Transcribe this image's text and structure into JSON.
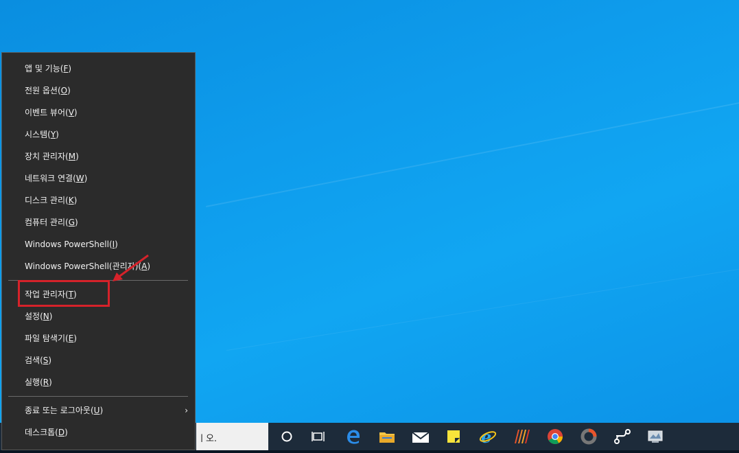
{
  "menu": {
    "items": [
      {
        "label": "앱 및 기능",
        "key": "F"
      },
      {
        "label": "전원 옵션",
        "key": "O"
      },
      {
        "label": "이벤트 뷰어",
        "key": "V"
      },
      {
        "label": "시스템",
        "key": "Y"
      },
      {
        "label": "장치 관리자",
        "key": "M"
      },
      {
        "label": "네트워크 연결",
        "key": "W"
      },
      {
        "label": "디스크 관리",
        "key": "K"
      },
      {
        "label": "컴퓨터 관리",
        "key": "G"
      },
      {
        "label": "Windows PowerShell",
        "key": "I"
      },
      {
        "label": "Windows PowerShell(관리자)",
        "key": "A"
      },
      {
        "label": "작업 관리자",
        "key": "T"
      },
      {
        "label": "설정",
        "key": "N"
      },
      {
        "label": "파일 탐색기",
        "key": "E"
      },
      {
        "label": "검색",
        "key": "S"
      },
      {
        "label": "실행",
        "key": "R"
      },
      {
        "label": "종료 또는 로그아웃",
        "key": "U",
        "arrow": "›"
      },
      {
        "label": "데스크톱",
        "key": "D"
      }
    ]
  },
  "taskbar": {
    "search_text": "ㅣ오.",
    "icons": [
      "cortana-icon",
      "task-view-icon",
      "edge-icon",
      "file-explorer-icon",
      "mail-icon",
      "sticky-notes-icon",
      "internet-explorer-icon",
      "app-stripes-icon",
      "chrome-icon",
      "circle-app-icon",
      "fn-app-icon",
      "monitor-app-icon"
    ]
  },
  "annotation": {
    "highlight_color": "#d6222a"
  }
}
